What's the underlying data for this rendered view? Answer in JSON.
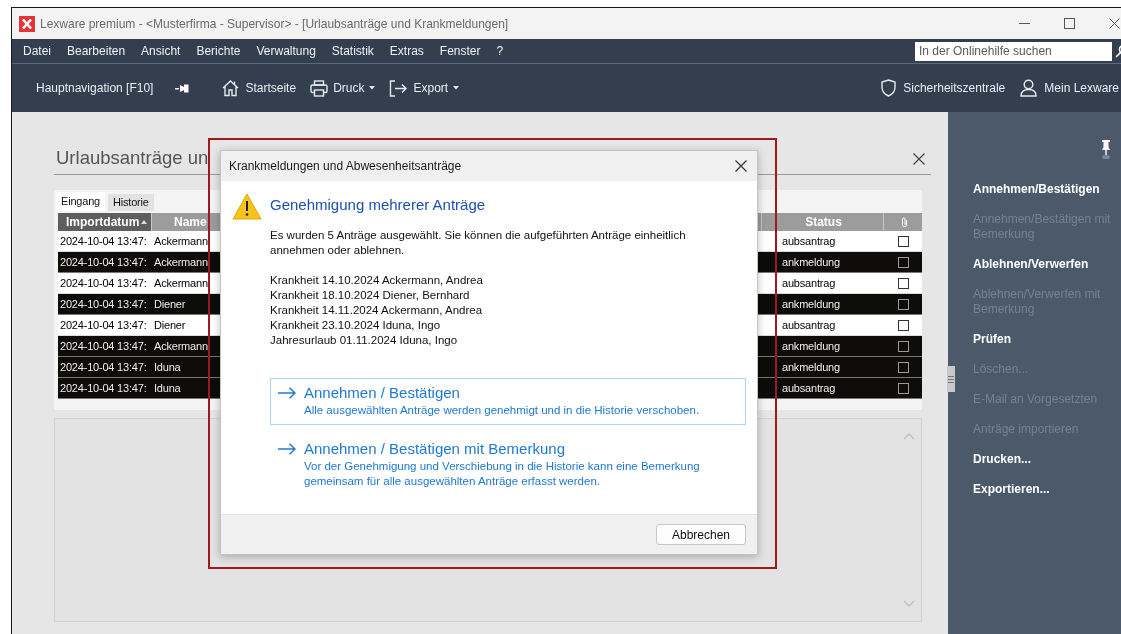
{
  "window": {
    "title": "Lexware premium - <Musterfirma - Supervisor> - [Urlaubsanträge und Krankmeldungen]"
  },
  "menu_bar": {
    "items": [
      "Datei",
      "Bearbeiten",
      "Ansicht",
      "Berichte",
      "Verwaltung",
      "Statistik",
      "Extras",
      "Fenster",
      "?"
    ],
    "search": {
      "placeholder": "In der Onlinehilfe suchen"
    }
  },
  "toolbar": {
    "navigation_label": "Hauptnavigation [F10]",
    "items": [
      {
        "kind": "home",
        "label": "Startseite",
        "dropdown": false
      },
      {
        "kind": "print",
        "label": "Druck",
        "dropdown": true
      },
      {
        "kind": "export",
        "label": "Export",
        "dropdown": true
      }
    ],
    "right_items": [
      {
        "kind": "shield",
        "label": "Sicherheitszentrale"
      },
      {
        "kind": "user",
        "label": "Mein Lexware"
      }
    ]
  },
  "view": {
    "title": "Urlaubsanträge un",
    "tabs": [
      {
        "label": "Eingang",
        "selected": true
      },
      {
        "label": "Historie",
        "selected": false
      }
    ],
    "table": {
      "columns": [
        "Importdatum",
        "Name",
        "Status"
      ],
      "rows": [
        {
          "importdatum": "2024-10-04 13:47:",
          "name": "Ackermann",
          "status": "aubsantrag",
          "selected": false,
          "attachment": false
        },
        {
          "importdatum": "2024-10-04 13:47:",
          "name": "Ackermann",
          "status": "ankmeldung",
          "selected": true,
          "attachment": false
        },
        {
          "importdatum": "2024-10-04 13:47:",
          "name": "Ackermann",
          "status": "aubsantrag",
          "selected": false,
          "attachment": false
        },
        {
          "importdatum": "2024-10-04 13:47:",
          "name": "Diener",
          "status": "ankmeldung",
          "selected": true,
          "attachment": false
        },
        {
          "importdatum": "2024-10-04 13:47:",
          "name": "Diener",
          "status": "aubsantrag",
          "selected": false,
          "attachment": false
        },
        {
          "importdatum": "2024-10-04 13:47:",
          "name": "Ackermann",
          "status": "ankmeldung",
          "selected": true,
          "attachment": false
        },
        {
          "importdatum": "2024-10-04 13:47:",
          "name": "Iduna",
          "status": "ankmeldung",
          "selected": true,
          "attachment": false
        },
        {
          "importdatum": "2024-10-04 13:47:",
          "name": "Iduna",
          "status": "aubsantrag",
          "selected": true,
          "attachment": false
        }
      ]
    }
  },
  "side_panel": {
    "actions": [
      {
        "label": "Annehmen/Bestätigen",
        "disabled": false
      },
      {
        "label": "Annehmen/Bestätigen mit Bemerkung",
        "disabled": true
      },
      {
        "label": "Ablehnen/Verwerfen",
        "disabled": false
      },
      {
        "label": "Ablehnen/Verwerfen mit Bemerkung",
        "disabled": true
      },
      {
        "label": "Prüfen",
        "disabled": false
      },
      {
        "label": "Löschen...",
        "disabled": true
      },
      {
        "label": "E-Mail an Vorgesetzten",
        "disabled": true
      },
      {
        "label": "Anträge importieren",
        "disabled": true
      },
      {
        "label": "Drucken...",
        "disabled": false
      },
      {
        "label": "Exportieren...",
        "disabled": false
      }
    ]
  },
  "dialog": {
    "title": "Krankmeldungen und Abwesenheitsanträge",
    "heading": "Genehmigung mehrerer Anträge",
    "message": "Es wurden 5 Anträge ausgewählt. Sie können die aufgeführten Anträge einheitlich annehmen oder ablehnen.",
    "requests": [
      "Krankheit 14.10.2024 Ackermann, Andrea",
      "Krankheit 18.10.2024 Diener, Bernhard",
      "Krankheit 14.11.2024 Ackermann, Andrea",
      "Krankheit 23.10.2024 Iduna, Ingo",
      "Jahresurlaub 01.11.2024 Iduna, Ingo"
    ],
    "options": [
      {
        "title": "Annehmen / Bestätigen",
        "description": "Alle ausgewählten Anträge werden genehmigt und in die Historie verschoben.",
        "focused": true
      },
      {
        "title": "Annehmen / Bestätigen mit Bemerkung",
        "description": "Vor der Genehmigung und Verschiebung in die Historie kann eine Bemerkung gemeinsam für alle ausgewählten Anträge erfasst werden.",
        "focused": false
      }
    ],
    "cancel_button": "Abbrechen"
  }
}
